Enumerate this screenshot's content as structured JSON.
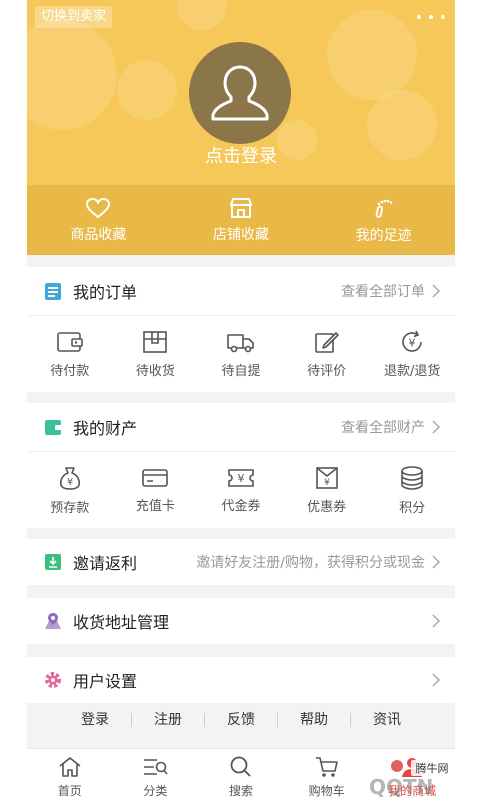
{
  "header": {
    "switch_label": "切换到卖家",
    "login_label": "点击登录",
    "shortcuts": [
      {
        "label": "商品收藏",
        "icon": "heart-icon"
      },
      {
        "label": "店铺收藏",
        "icon": "store-icon"
      },
      {
        "label": "我的足迹",
        "icon": "footprint-icon"
      }
    ]
  },
  "orders": {
    "title": "我的订单",
    "link": "查看全部订单",
    "items": [
      {
        "label": "待付款",
        "icon": "wallet-icon"
      },
      {
        "label": "待收货",
        "icon": "package-icon"
      },
      {
        "label": "待自提",
        "icon": "truck-icon"
      },
      {
        "label": "待评价",
        "icon": "edit-icon"
      },
      {
        "label": "退款/退货",
        "icon": "refund-icon"
      }
    ]
  },
  "assets": {
    "title": "我的财产",
    "link": "查看全部财产",
    "items": [
      {
        "label": "预存款",
        "icon": "money-bag-icon"
      },
      {
        "label": "充值卡",
        "icon": "card-icon"
      },
      {
        "label": "代金券",
        "icon": "voucher-icon"
      },
      {
        "label": "优惠券",
        "icon": "coupon-icon"
      },
      {
        "label": "积分",
        "icon": "coins-icon"
      }
    ]
  },
  "invite": {
    "title": "邀请返利",
    "desc": "邀请好友注册/购物，获得积分或现金"
  },
  "address": {
    "title": "收货地址管理"
  },
  "settings": {
    "title": "用户设置"
  },
  "footer_links": [
    "登录",
    "注册",
    "反馈",
    "帮助",
    "资讯"
  ],
  "tabbar": [
    {
      "label": "首页",
      "icon": "home-icon"
    },
    {
      "label": "分类",
      "icon": "category-icon"
    },
    {
      "label": "搜索",
      "icon": "search-icon"
    },
    {
      "label": "购物车",
      "icon": "cart-icon"
    },
    {
      "label": "我的商城",
      "icon": "user-icon",
      "active": true
    }
  ],
  "watermark": {
    "brand": "腾牛网",
    "logo_text": "QQTN.com"
  },
  "colors": {
    "header": "#f6c85a",
    "header_bar": "#e9b947",
    "avatar": "#8a7648",
    "active_tab": "#e84545"
  }
}
